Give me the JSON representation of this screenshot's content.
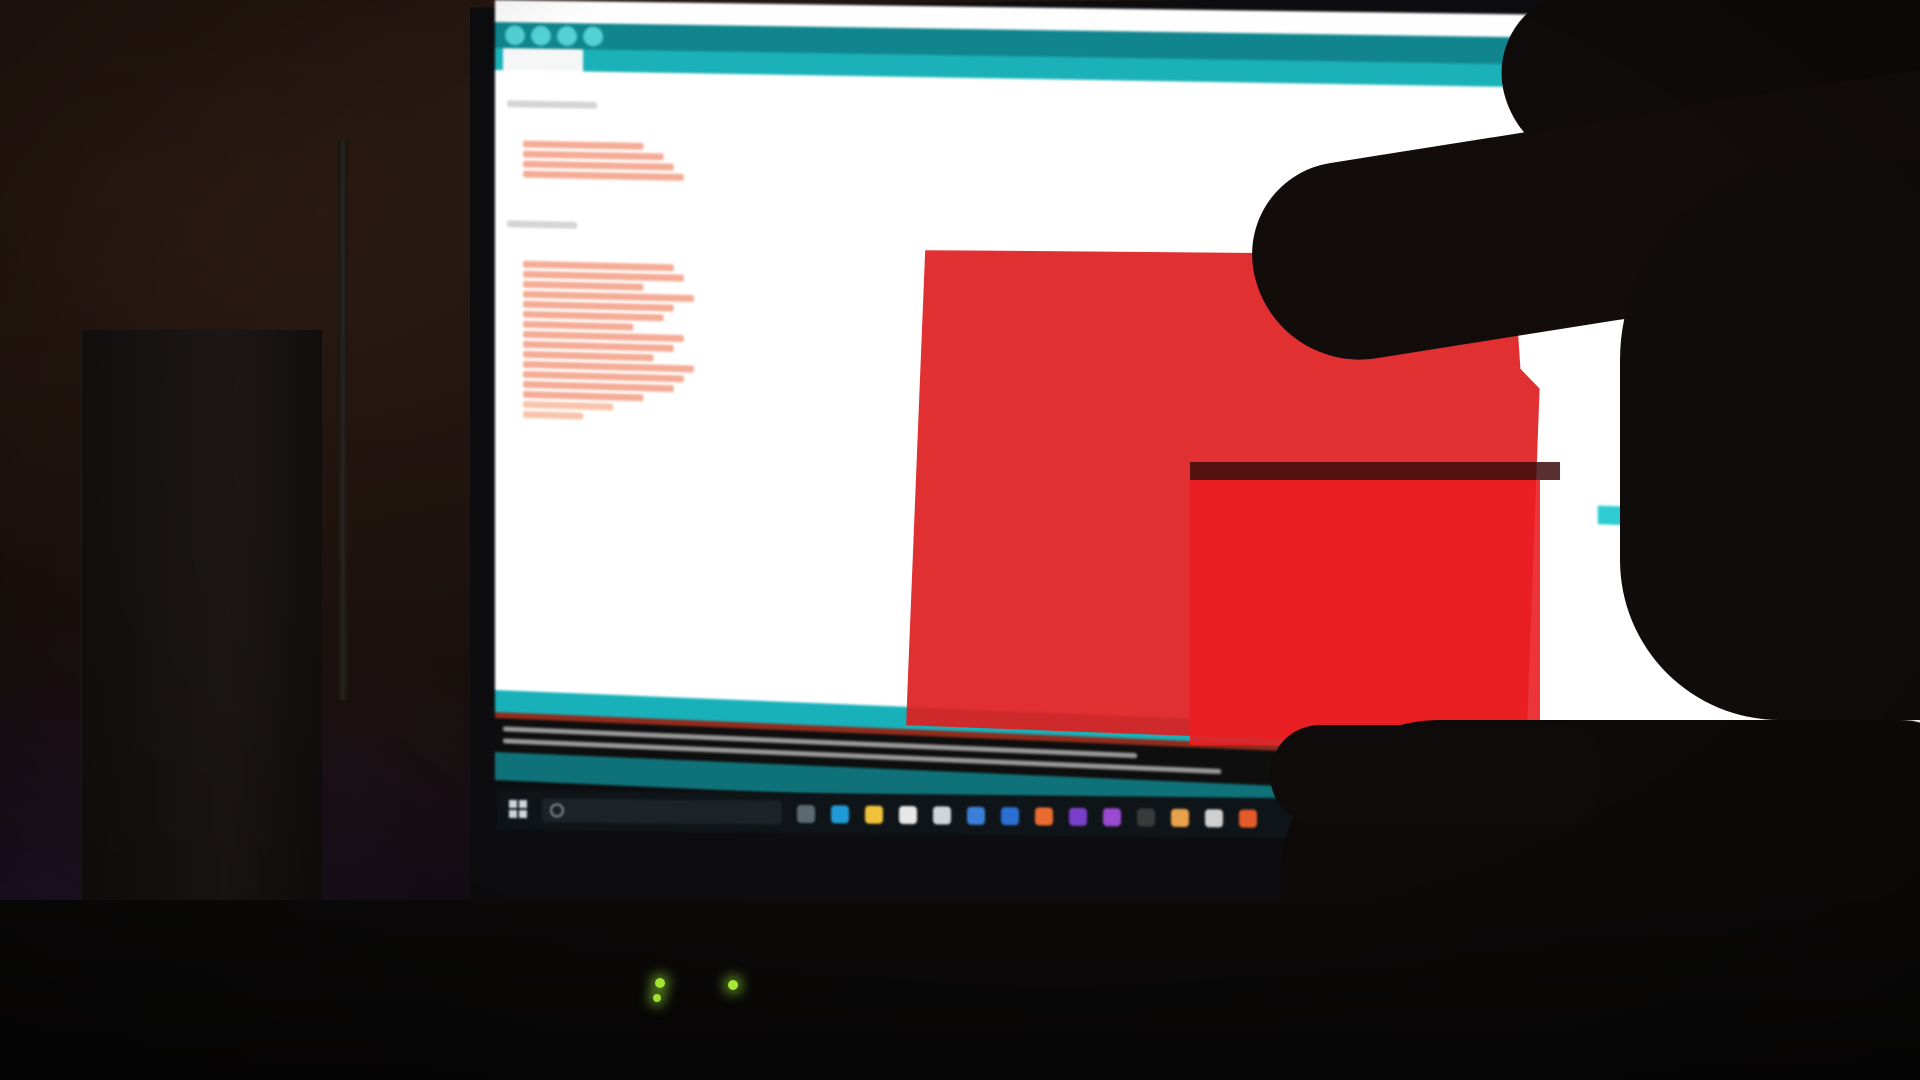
{
  "scene": {
    "description_label": "",
    "screen": {
      "window_title": "",
      "tab_label": "",
      "taskbar_search_placeholder": ""
    }
  },
  "colors": {
    "filter_red": "#de1e20",
    "ide_teal": "#17a9b1",
    "ide_dark_teal": "#0f7f86",
    "led_green": "#b8ff3b"
  },
  "icons": {
    "taskbar": [
      "windows-icon",
      "search-icon",
      "task-view-icon",
      "edge-icon",
      "file-explorer-icon",
      "store-icon",
      "mail-icon",
      "pen-icon",
      "app-icon",
      "chrome-icon",
      "app-icon",
      "app-icon",
      "app-icon",
      "app-icon",
      "app-icon",
      "app-icon"
    ]
  }
}
